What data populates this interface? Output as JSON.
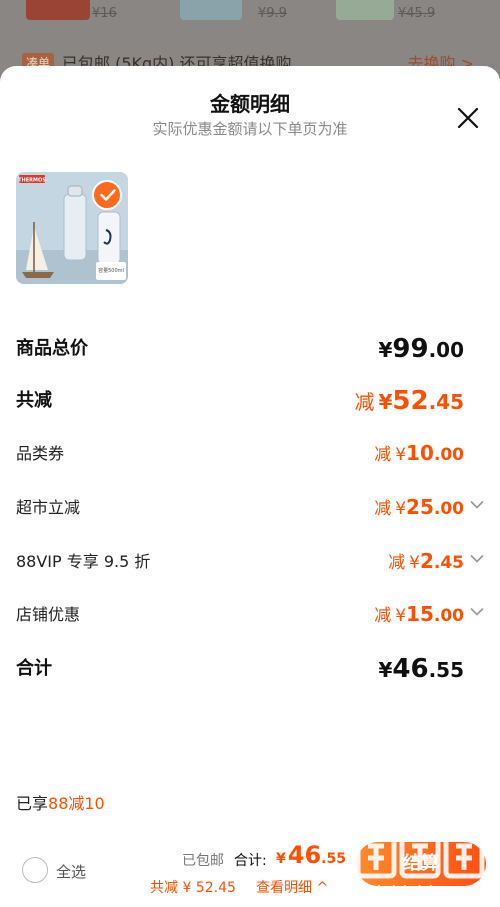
{
  "background": {
    "prices": [
      "¥16",
      "¥9.9",
      "¥45.9"
    ],
    "promo_tag": "凑单",
    "promo_text": "已包邮 (5Kg内)   还可享超值换购",
    "promo_link": "去换购 >"
  },
  "sheet": {
    "title": "金额明细",
    "subtitle": "实际优惠金额请以下单页为准",
    "close_icon": "close-icon",
    "product_brand": "THERMOS",
    "product_label": "容量500ml"
  },
  "rows": [
    {
      "label": "商品总价",
      "minus": "",
      "yen": "¥",
      "int": "99",
      "dec": ".00",
      "emphasis": "black",
      "chevron": false
    },
    {
      "label": "共减",
      "minus": "减",
      "yen": "¥",
      "int": "52",
      "dec": ".45",
      "emphasis": "orange",
      "chevron": false
    },
    {
      "label": "品类券",
      "minus": "减",
      "yen": "¥",
      "int": "10",
      "dec": ".00",
      "emphasis": "orange",
      "chevron": false
    },
    {
      "label": "超市立减",
      "minus": "减",
      "yen": "¥",
      "int": "25",
      "dec": ".00",
      "emphasis": "orange",
      "chevron": true
    },
    {
      "label": "88VIP 专享 9.5 折",
      "minus": "减",
      "yen": "¥",
      "int": "2",
      "dec": ".45",
      "emphasis": "orange",
      "chevron": true
    },
    {
      "label": "店铺优惠",
      "minus": "减",
      "yen": "¥",
      "int": "15",
      "dec": ".00",
      "emphasis": "orange",
      "chevron": true
    },
    {
      "label": "合计",
      "minus": "",
      "yen": "¥",
      "int": "46",
      "dec": ".55",
      "emphasis": "black",
      "chevron": false
    }
  ],
  "enjoy": {
    "prefix": "已享",
    "highlight": "88减10"
  },
  "footer": {
    "select_all": "全选",
    "shipping": "已包邮",
    "total_label": "合计:",
    "total_yen": "¥",
    "total_int": "46",
    "total_dec": ".55",
    "saved": "共减 ¥ 52.45",
    "detail_link": "查看明细 ^",
    "pay_button": "结算"
  },
  "watermark": {
    "site": "zhizhizhi.com"
  },
  "colors": {
    "accent": "#ff5000",
    "text": "#111111",
    "muted": "#8a8a8a"
  }
}
